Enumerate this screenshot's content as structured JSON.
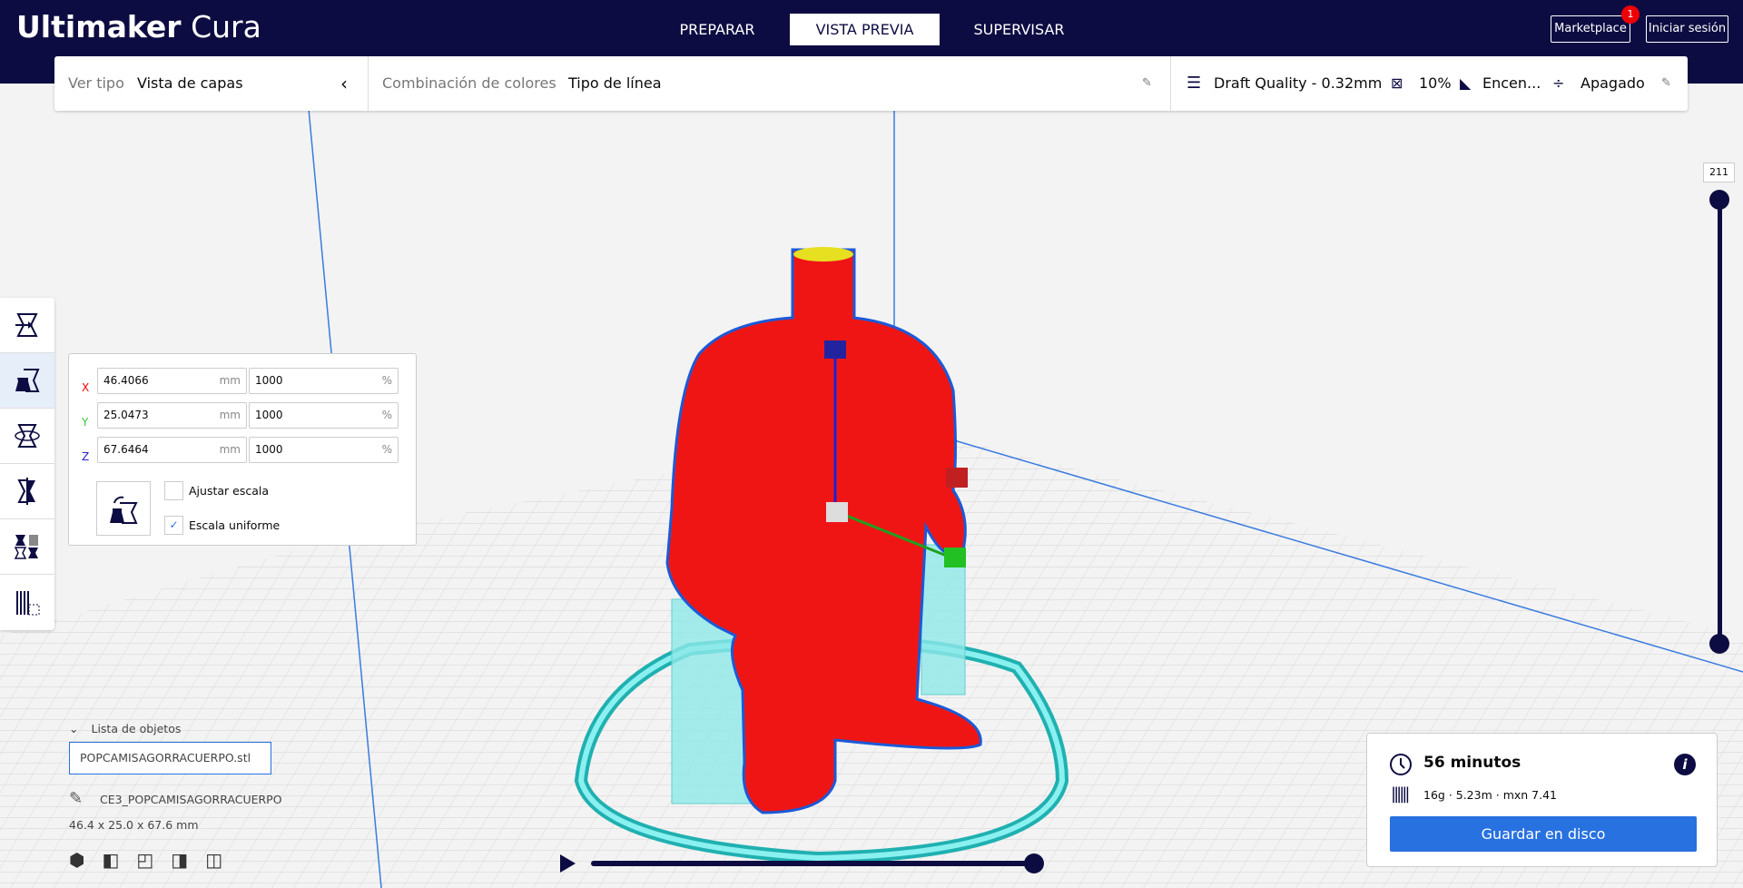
{
  "header": {
    "logo": {
      "brand": "Ultimaker",
      "product": "Cura"
    },
    "tabs": [
      {
        "label": "PREPARAR"
      },
      {
        "label": "VISTA PREVIA",
        "active": true
      },
      {
        "label": "SUPERVISAR"
      }
    ],
    "marketplace_label": "Marketplace",
    "marketplace_badge": "1",
    "signin_label": "Iniciar sesión"
  },
  "toolbar": {
    "view_type_label": "Ver tipo",
    "view_type_value": "Vista de capas",
    "color_scheme_label": "Combinación de colores",
    "color_scheme_value": "Tipo de línea",
    "quality": "Draft Quality - 0.32mm",
    "infill": "10%",
    "support": "Encen...",
    "adhesion": "Apagado"
  },
  "scale": {
    "x": {
      "label": "X",
      "mm": "46.4066",
      "percent": "1000"
    },
    "y": {
      "label": "Y",
      "mm": "25.0473",
      "percent": "1000"
    },
    "z": {
      "label": "Z",
      "mm": "67.6464",
      "percent": "1000"
    },
    "unit_mm": "mm",
    "unit_percent": "%",
    "snap_label": "Ajustar escala",
    "uniform_label": "Escala uniforme",
    "snap_checked": false,
    "uniform_checked": true
  },
  "objects": {
    "header": "Lista de objetos",
    "item": "POPCAMISAGORRACUERPO.stl",
    "job_name": "CE3_POPCAMISAGORRACUERPO",
    "dimensions": "46.4 x 25.0 x 67.6 mm"
  },
  "layer_slider": {
    "value": "211",
    "max": 211
  },
  "playback": {
    "progress": 1.0
  },
  "print_info": {
    "time": "56 minutos",
    "material": "16g · 5.23m · mxn 7.41",
    "save_label": "Guardar en disco"
  },
  "colors": {
    "header": "#0d0c42",
    "accent": "#2871e0",
    "model": "#ff1a1a",
    "support": "#7ee8e8"
  }
}
